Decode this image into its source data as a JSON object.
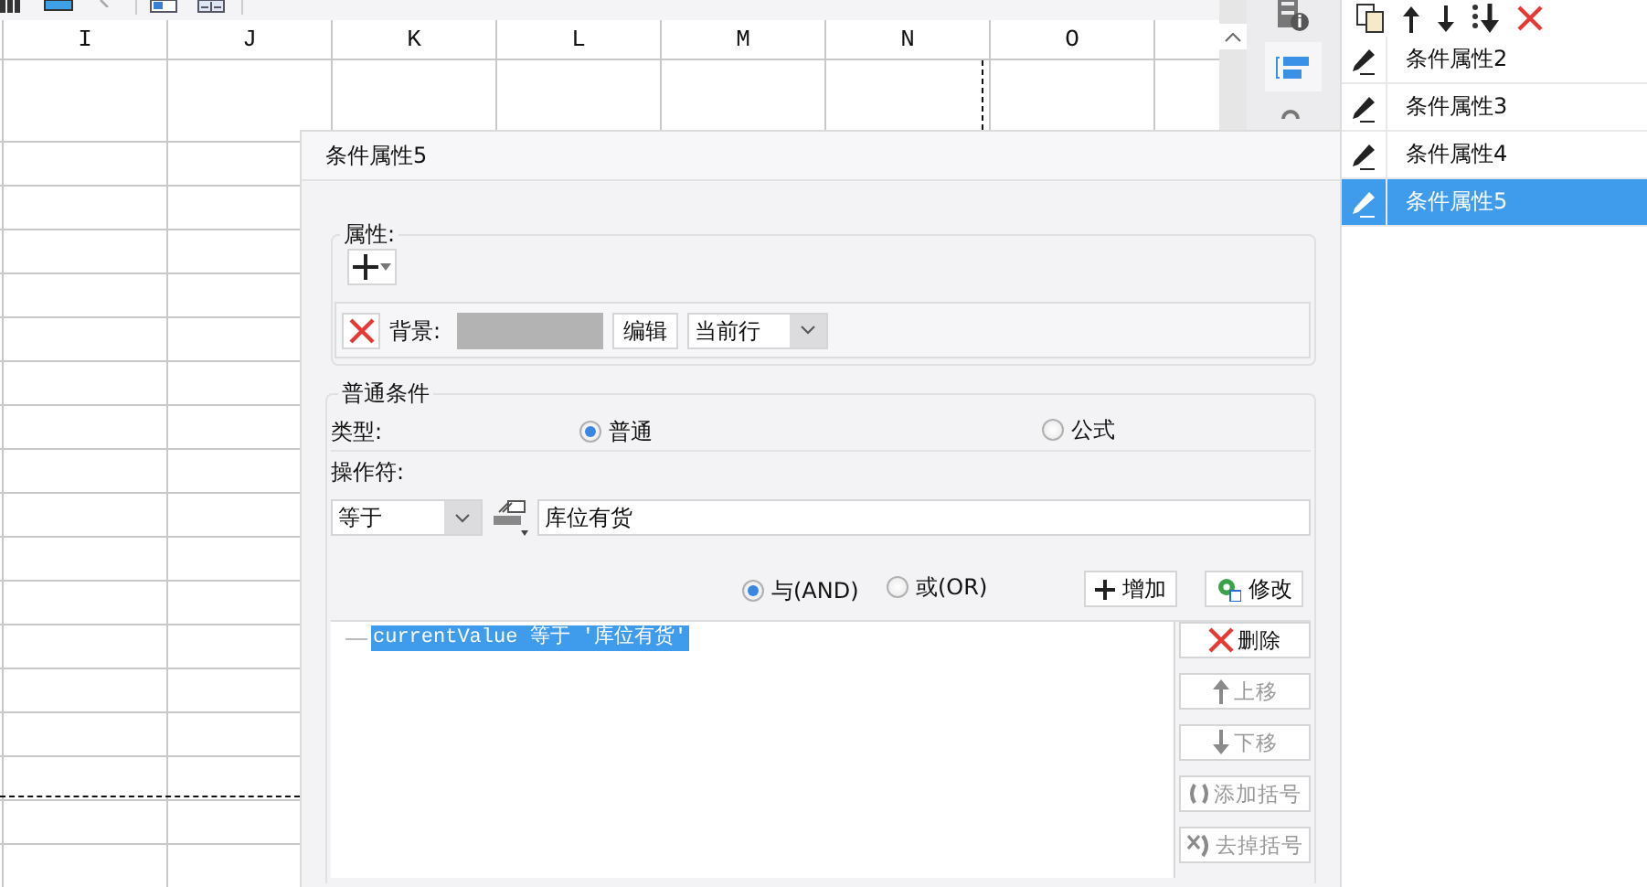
{
  "sheet": {
    "columns": [
      "I",
      "J",
      "K",
      "L",
      "M",
      "N",
      "O"
    ]
  },
  "dialog": {
    "title": "条件属性5",
    "properties": {
      "legend": "属性:",
      "background_label": "背景:",
      "edit_button": "编辑",
      "scope": "当前行"
    },
    "condition": {
      "legend": "普通条件",
      "type_label": "类型:",
      "type_options": [
        {
          "label": "普通",
          "selected": true
        },
        {
          "label": "公式",
          "selected": false
        }
      ],
      "operator_label": "操作符:",
      "operator": "等于",
      "value": "库位有货",
      "join_options": [
        {
          "label": "与(AND)",
          "selected": true
        },
        {
          "label": "或(OR)",
          "selected": false
        }
      ],
      "add_button": "增加",
      "modify_button": "修改",
      "expressions": [
        {
          "text": "currentValue 等于 '库位有货'",
          "selected": true
        }
      ],
      "actions": [
        {
          "kind": "delete",
          "label": "删除",
          "disabled": false
        },
        {
          "kind": "up",
          "label": "上移",
          "disabled": true
        },
        {
          "kind": "down",
          "label": "下移",
          "disabled": true
        },
        {
          "kind": "add-bracket",
          "label": "添加括号",
          "disabled": true
        },
        {
          "kind": "remove-bracket",
          "label": "去掉括号",
          "disabled": true
        }
      ]
    }
  },
  "conditions": [
    {
      "label": "条件属性2",
      "selected": false
    },
    {
      "label": "条件属性3",
      "selected": false
    },
    {
      "label": "条件属性4",
      "selected": false
    },
    {
      "label": "条件属性5",
      "selected": true
    }
  ]
}
